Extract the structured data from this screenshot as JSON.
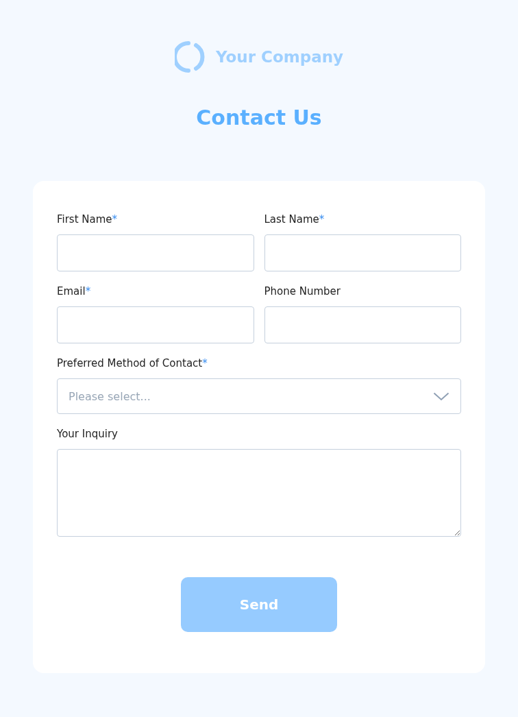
{
  "logo": {
    "name": "Your Company"
  },
  "title": "Contact Us",
  "form": {
    "fields": [
      {
        "kind": "text",
        "label": "First Name",
        "mark": "*"
      },
      {
        "kind": "text",
        "label": "Last Name",
        "mark": "*"
      },
      {
        "kind": "text",
        "label": "Email",
        "mark": "*"
      },
      {
        "kind": "text",
        "label": "Phone Number"
      },
      {
        "kind": "select",
        "label": "Preferred Method of Contact",
        "mark": "*",
        "placeholder": "Please select..."
      },
      {
        "kind": "textarea",
        "label": "Your Inquiry"
      }
    ],
    "submit": {
      "label": "Send",
      "disabled": true
    }
  }
}
